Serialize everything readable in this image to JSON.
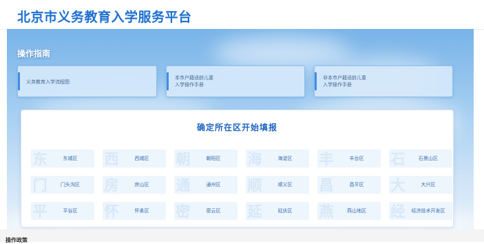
{
  "header": {
    "title": "北京市义务教育入学服务平台"
  },
  "guide": {
    "heading": "操作指南",
    "cards": [
      {
        "line1": "义务教育入学流程图",
        "line2": ""
      },
      {
        "line1": "本市户籍适龄儿童",
        "line2": "入学操作手册"
      },
      {
        "line1": "非本市户籍适龄儿童",
        "line2": "入学操作手册"
      }
    ]
  },
  "districts": {
    "title": "确定所在区开始填报",
    "items": [
      {
        "label": "东城区",
        "watermark": "东"
      },
      {
        "label": "西城区",
        "watermark": "西"
      },
      {
        "label": "朝阳区",
        "watermark": "朝"
      },
      {
        "label": "海淀区",
        "watermark": "海"
      },
      {
        "label": "丰台区",
        "watermark": "丰"
      },
      {
        "label": "石景山区",
        "watermark": "石"
      },
      {
        "label": "门头沟区",
        "watermark": "门"
      },
      {
        "label": "房山区",
        "watermark": "房"
      },
      {
        "label": "通州区",
        "watermark": "通"
      },
      {
        "label": "顺义区",
        "watermark": "顺"
      },
      {
        "label": "昌平区",
        "watermark": "昌"
      },
      {
        "label": "大兴区",
        "watermark": "大"
      },
      {
        "label": "平谷区",
        "watermark": "平"
      },
      {
        "label": "怀柔区",
        "watermark": "怀"
      },
      {
        "label": "密云区",
        "watermark": "密"
      },
      {
        "label": "延庆区",
        "watermark": "延"
      },
      {
        "label": "燕山地区",
        "watermark": "燕"
      },
      {
        "label": "经济技术开发区",
        "watermark": "经"
      }
    ]
  },
  "footer": {
    "next_section_label": "操作政策"
  },
  "colors": {
    "brand": "#1e6fd0",
    "accent": "#3f8de0",
    "button_bg": "#edf5fd"
  }
}
